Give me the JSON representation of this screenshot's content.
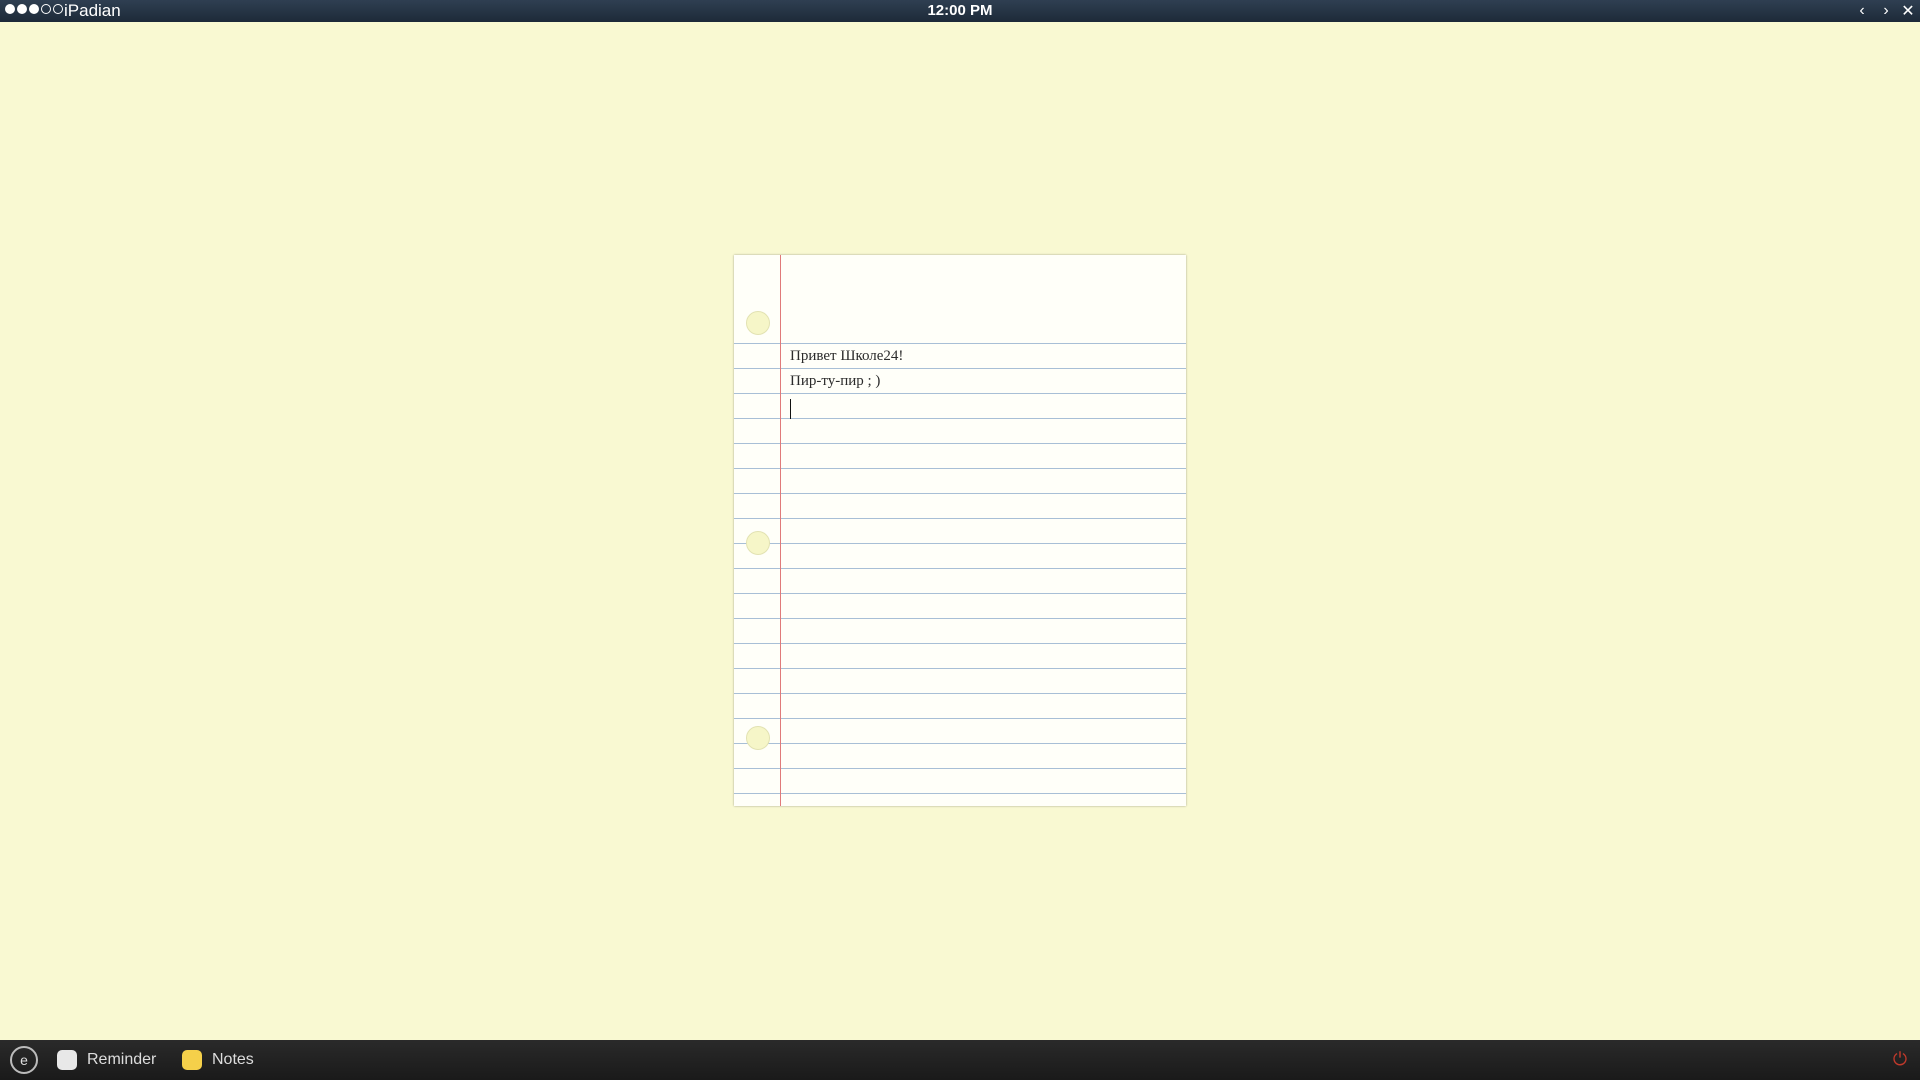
{
  "status_bar": {
    "signal_dots": [
      "full",
      "full",
      "full",
      "empty",
      "empty"
    ],
    "carrier": "iPadian",
    "time": "12:00 PM"
  },
  "window_controls": {
    "back_icon": "‹",
    "forward_icon": "›",
    "close_icon": "✕"
  },
  "note": {
    "lines": [
      "Привет Школе24!",
      "Пир-ту-пир ; )"
    ]
  },
  "taskbar": {
    "start_icon": "e",
    "items": [
      {
        "label": "Reminder",
        "icon": "reminder-icon",
        "color": "#e8e8e8"
      },
      {
        "label": "Notes",
        "icon": "notes-icon",
        "color": "#f5d04a"
      }
    ],
    "power_icon": "⏻"
  },
  "colors": {
    "background": "#f9f9d2",
    "margin_line": "#e07a7a",
    "ruled_line": "#a8bfd6",
    "power": "#c0392b"
  }
}
